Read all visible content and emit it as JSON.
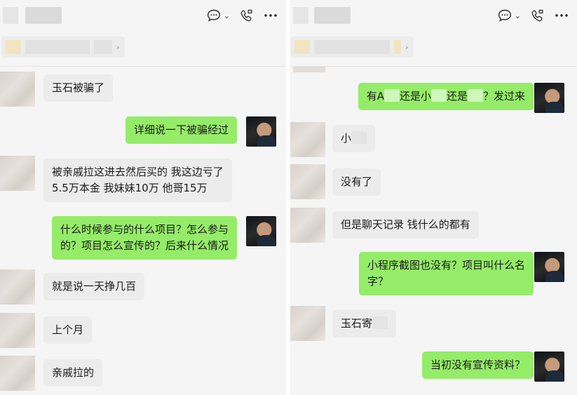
{
  "left": {
    "messages": [
      {
        "side": "in",
        "text": "玉石被骗了"
      },
      {
        "side": "out",
        "text": "详细说一下被骗经过"
      },
      {
        "side": "in",
        "line1": "被亲戚拉这进去然后买的 我这边亏了",
        "line2": "5.5万本金 我妹妹10万 他哥15万"
      },
      {
        "side": "out",
        "line1": "什么时候参与的什么项目？怎么参与",
        "line2": "的？项目怎么宣传的？后来什么情况"
      },
      {
        "side": "in",
        "text": "就是说一天挣几百"
      },
      {
        "side": "in",
        "text": "上个月"
      },
      {
        "side": "in",
        "text": "亲戚拉的"
      }
    ]
  },
  "right": {
    "messages": [
      {
        "side": "out",
        "p1": "有A",
        "p2": "还是小",
        "p3": "还是",
        "p4": "？发过来"
      },
      {
        "side": "in",
        "text": "小"
      },
      {
        "side": "in",
        "text": "没有了"
      },
      {
        "side": "in",
        "text": "但是聊天记录 钱什么的都有"
      },
      {
        "side": "out",
        "line1": "小程序截图也没有？项目叫什么名",
        "line2": "字？"
      },
      {
        "side": "in",
        "text": "玉石寄"
      },
      {
        "side": "out",
        "text": "当初没有宣传资料？"
      }
    ]
  },
  "icons": {
    "chat": "chat-bubble-icon",
    "call": "video-call-icon",
    "more": "more-icon"
  }
}
